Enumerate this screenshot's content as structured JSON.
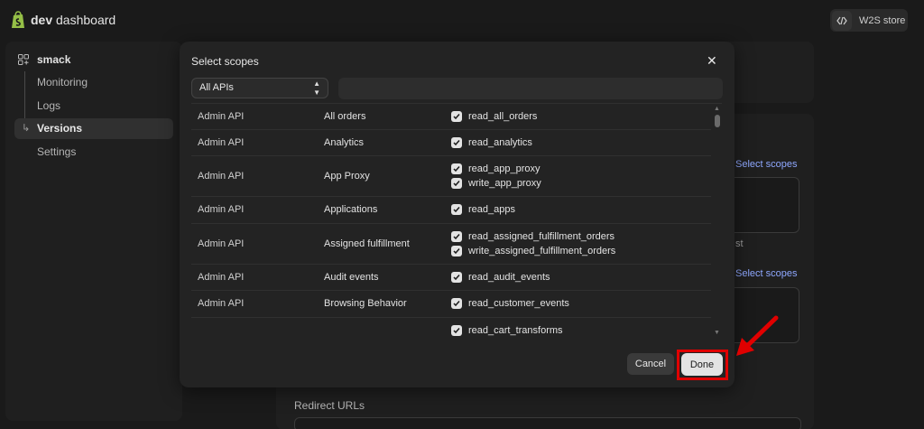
{
  "topbar": {
    "app_title_bold": "dev",
    "app_title_rest": " dashboard",
    "store_button_label": "W2S store"
  },
  "sidebar": {
    "app_name": "smack",
    "items": [
      {
        "label": "Monitoring"
      },
      {
        "label": "Logs"
      },
      {
        "label": "Versions",
        "active": true
      },
      {
        "label": "Settings"
      }
    ]
  },
  "background": {
    "select_scopes_link": "Select scopes",
    "partial_text": "st",
    "redirect_label": "Redirect URLs"
  },
  "modal": {
    "title": "Select scopes",
    "api_filter": {
      "selected": "All APIs"
    },
    "search": {
      "value": "",
      "placeholder": ""
    },
    "rows": [
      {
        "api": "Admin API",
        "resource": "All orders",
        "scopes": [
          "read_all_orders"
        ]
      },
      {
        "api": "Admin API",
        "resource": "Analytics",
        "scopes": [
          "read_analytics"
        ]
      },
      {
        "api": "Admin API",
        "resource": "App Proxy",
        "scopes": [
          "read_app_proxy",
          "write_app_proxy"
        ]
      },
      {
        "api": "Admin API",
        "resource": "Applications",
        "scopes": [
          "read_apps"
        ]
      },
      {
        "api": "Admin API",
        "resource": "Assigned fulfillment",
        "scopes": [
          "read_assigned_fulfillment_orders",
          "write_assigned_fulfillment_orders"
        ]
      },
      {
        "api": "Admin API",
        "resource": "Audit events",
        "scopes": [
          "read_audit_events"
        ]
      },
      {
        "api": "Admin API",
        "resource": "Browsing Behavior",
        "scopes": [
          "read_customer_events"
        ]
      },
      {
        "api": "",
        "resource": "",
        "scopes": [
          "read_cart_transforms"
        ]
      }
    ],
    "cancel_label": "Cancel",
    "done_label": "Done"
  },
  "colors": {
    "background": "#1a1a1a",
    "modal": "#232323",
    "highlight": "#e00000",
    "link": "#8fa8ff"
  }
}
